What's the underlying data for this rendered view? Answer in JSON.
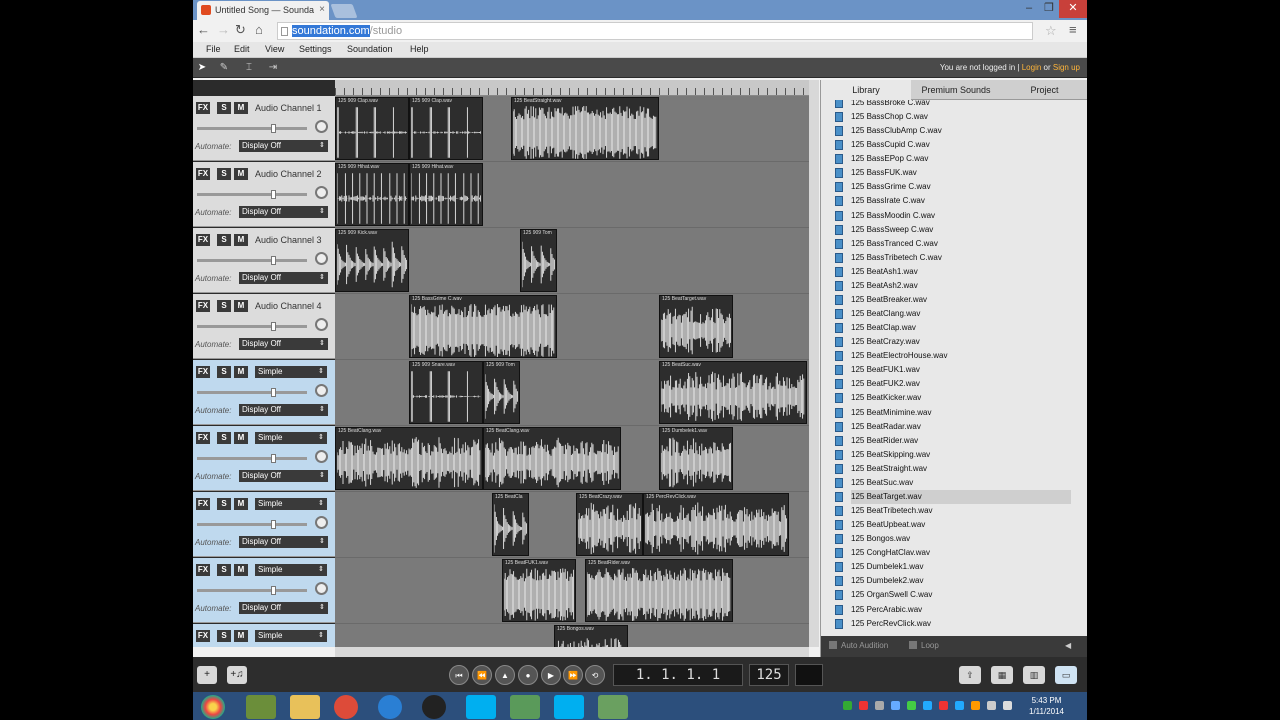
{
  "browser": {
    "tab_title": "Untitled Song — Sounda",
    "tab_close": "×",
    "url_selected": "soundation.com",
    "url_rest": "/studio",
    "win_min": "–",
    "win_max": "❐",
    "win_close": "✕"
  },
  "menubar": {
    "items": [
      "File",
      "Edit",
      "View",
      "Settings",
      "Soundation",
      "Help"
    ]
  },
  "apptoolbar": {
    "login_prefix": "You are not logged in | ",
    "login_link": "Login",
    "login_or": " or ",
    "signup_link": "Sign up"
  },
  "tracks": [
    {
      "fx": "FX",
      "solo": "S",
      "mute": "M",
      "name": "Audio Channel 1",
      "automate_label": "Automate:",
      "automate_value": "Display Off",
      "type": "audio"
    },
    {
      "fx": "FX",
      "solo": "S",
      "mute": "M",
      "name": "Audio Channel 2",
      "automate_label": "Automate:",
      "automate_value": "Display Off",
      "type": "audio"
    },
    {
      "fx": "FX",
      "solo": "S",
      "mute": "M",
      "name": "Audio Channel 3",
      "automate_label": "Automate:",
      "automate_value": "Display Off",
      "type": "audio"
    },
    {
      "fx": "FX",
      "solo": "S",
      "mute": "M",
      "name": "Audio Channel 4",
      "automate_label": "Automate:",
      "automate_value": "Display Off",
      "type": "audio"
    },
    {
      "fx": "FX",
      "solo": "S",
      "mute": "M",
      "name": "Simple",
      "automate_label": "Automate:",
      "automate_value": "Display Off",
      "type": "instrument"
    },
    {
      "fx": "FX",
      "solo": "S",
      "mute": "M",
      "name": "Simple",
      "automate_label": "Automate:",
      "automate_value": "Display Off",
      "type": "instrument"
    },
    {
      "fx": "FX",
      "solo": "S",
      "mute": "M",
      "name": "Simple",
      "automate_label": "Automate:",
      "automate_value": "Display Off",
      "type": "instrument"
    },
    {
      "fx": "FX",
      "solo": "S",
      "mute": "M",
      "name": "Simple",
      "automate_label": "Automate:",
      "automate_value": "Display Off",
      "type": "instrument"
    },
    {
      "fx": "FX",
      "solo": "S",
      "mute": "M",
      "name": "Simple",
      "automate_label": "Automate:",
      "automate_value": "",
      "type": "instrument"
    }
  ],
  "clips": [
    {
      "lane": 0,
      "start": 0,
      "len": 74,
      "label": "125 909 Clap.wav",
      "style": "sparse"
    },
    {
      "lane": 0,
      "start": 74,
      "len": 74,
      "label": "125 909 Clap.wav",
      "style": "sparse"
    },
    {
      "lane": 0,
      "start": 176,
      "len": 148,
      "label": "125 BeatStraight.wav",
      "style": "dense"
    },
    {
      "lane": 1,
      "start": 0,
      "len": 74,
      "label": "125 909 Hihat.wav",
      "style": "comb"
    },
    {
      "lane": 1,
      "start": 74,
      "len": 74,
      "label": "125 909 Hihat.wav",
      "style": "comb"
    },
    {
      "lane": 2,
      "start": 0,
      "len": 74,
      "label": "125 909 Kick.wav",
      "style": "kick"
    },
    {
      "lane": 2,
      "start": 185,
      "len": 37,
      "label": "125 909 Tom",
      "style": "kick"
    },
    {
      "lane": 3,
      "start": 74,
      "len": 148,
      "label": "125 BassGrime C.wav",
      "style": "dense"
    },
    {
      "lane": 3,
      "start": 324,
      "len": 74,
      "label": "125 BeatTarget.wav",
      "style": "mid"
    },
    {
      "lane": 4,
      "start": 74,
      "len": 74,
      "label": "125 909 Snare.wav",
      "style": "sparse"
    },
    {
      "lane": 4,
      "start": 148,
      "len": 37,
      "label": "125 909 Tom",
      "style": "kick"
    },
    {
      "lane": 4,
      "start": 324,
      "len": 148,
      "label": "125 BeatSuc.wav",
      "style": "mid"
    },
    {
      "lane": 5,
      "start": 0,
      "len": 148,
      "label": "125 BeatClang.wav",
      "style": "mid"
    },
    {
      "lane": 5,
      "start": 148,
      "len": 138,
      "label": "125 BeatClang.wav",
      "style": "mid"
    },
    {
      "lane": 5,
      "start": 324,
      "len": 74,
      "label": "125 Dumbelek1.wav",
      "style": "mid"
    },
    {
      "lane": 6,
      "start": 157,
      "len": 37,
      "label": "125 BeatCla",
      "style": "kick"
    },
    {
      "lane": 6,
      "start": 241,
      "len": 67,
      "label": "125 BeatCrazy.wav",
      "style": "mid"
    },
    {
      "lane": 6,
      "start": 308,
      "len": 146,
      "label": "125 PercRevClick.wav",
      "style": "mid"
    },
    {
      "lane": 7,
      "start": 167,
      "len": 74,
      "label": "125 BeatFUK1.wav",
      "style": "dense"
    },
    {
      "lane": 7,
      "start": 250,
      "len": 148,
      "label": "125 BeatRider.wav",
      "style": "dense"
    },
    {
      "lane": 8,
      "start": 219,
      "len": 74,
      "label": "125 Bongos.wav",
      "style": "mid"
    }
  ],
  "library": {
    "tabs": [
      "Library",
      "Premium Sounds",
      "Project"
    ],
    "items": [
      "125 BassBroke C.wav",
      "125 BassChop C.wav",
      "125 BassClubAmp C.wav",
      "125 BassCupid C.wav",
      "125 BassEPop C.wav",
      "125 BassFUK.wav",
      "125 BassGrime C.wav",
      "125 BassIrate C.wav",
      "125 BassMoodin C.wav",
      "125 BassSweep C.wav",
      "125 BassTranced C.wav",
      "125 BassTribetech C.wav",
      "125 BeatAsh1.wav",
      "125 BeatAsh2.wav",
      "125 BeatBreaker.wav",
      "125 BeatClang.wav",
      "125 BeatClap.wav",
      "125 BeatCrazy.wav",
      "125 BeatElectroHouse.wav",
      "125 BeatFUK1.wav",
      "125 BeatFUK2.wav",
      "125 BeatKicker.wav",
      "125 BeatMinimine.wav",
      "125 BeatRadar.wav",
      "125 BeatRider.wav",
      "125 BeatSkipping.wav",
      "125 BeatStraight.wav",
      "125 BeatSuc.wav",
      "125 BeatTarget.wav",
      "125 BeatTribetech.wav",
      "125 BeatUpbeat.wav",
      "125 Bongos.wav",
      "125 CongHatClav.wav",
      "125 Dumbelek1.wav",
      "125 Dumbelek2.wav",
      "125 OrganSwell C.wav",
      "125 PercArabic.wav",
      "125 PercRevClick.wav"
    ],
    "selected": "125 BeatTarget.wav",
    "auto_audition": "Auto Audition",
    "loop": "Loop"
  },
  "transport": {
    "position": "1. 1. 1.   1",
    "tempo": "125"
  },
  "taskbar": {
    "time": "5:43 PM",
    "date": "1/11/2014"
  },
  "colors": {
    "accent_link": "#ffb53a",
    "selection": "#3378d7",
    "taskbar": "#2c4f7c",
    "instrument_track": "#bfd9ee"
  }
}
